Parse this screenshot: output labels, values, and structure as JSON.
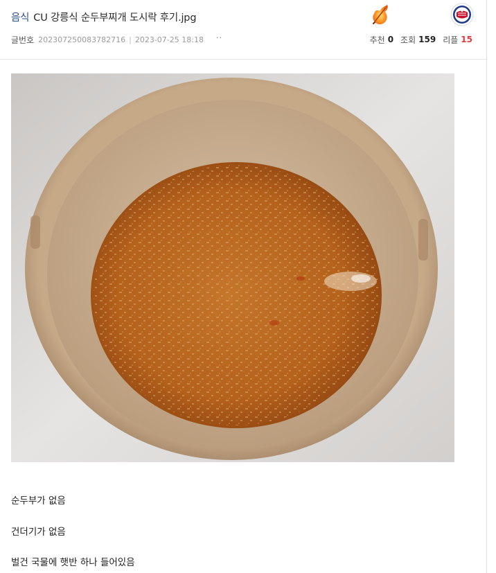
{
  "post": {
    "category": "음식",
    "title": "CU 강릉식 순두부찌개 도시락 후기.jpg",
    "meta": {
      "id_label": "글번호",
      "id_value": "20230725008378271​6",
      "date": "2023-07-25 18:18",
      "more": "··"
    },
    "stats": {
      "recommend_label": "추천",
      "recommend_value": "0",
      "views_label": "조회",
      "views_value": "159",
      "replies_label": "리플",
      "replies_value": "15"
    },
    "badges": {
      "fire_icon": "fire-badge-icon",
      "team_icon": "phillies-logo-icon",
      "fire_color": "#ff7a1a",
      "team_color": "#c8102e"
    }
  },
  "content": {
    "image_alt": "순두부찌개 도시락 사진",
    "lines": [
      "순두부가 없음",
      "건더기가 없음",
      "벌건 국물에 햇반 하나 들어있음"
    ]
  },
  "colors": {
    "category": "#2a4d8f",
    "replies": "#e03c3c",
    "soup": "#b8661e",
    "bowl": "#c9ad8a"
  }
}
